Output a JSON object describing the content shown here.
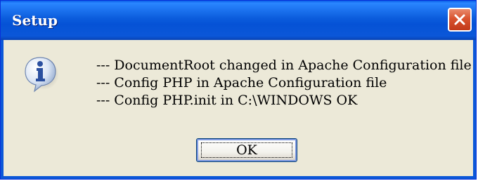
{
  "window": {
    "title": "Setup",
    "close_icon": "close-icon"
  },
  "dialog": {
    "icon": "info-icon",
    "messages": [
      "--- DocumentRoot changed in Apache Configuration file",
      "--- Config PHP in Apache Configuration file",
      "--- Config PHP.init in C:\\WINDOWS OK"
    ],
    "ok_label": "OK"
  },
  "colors": {
    "titlebar": "#0b57d8",
    "dialog_bg": "#ece9d8",
    "close_button": "#d9532f"
  }
}
